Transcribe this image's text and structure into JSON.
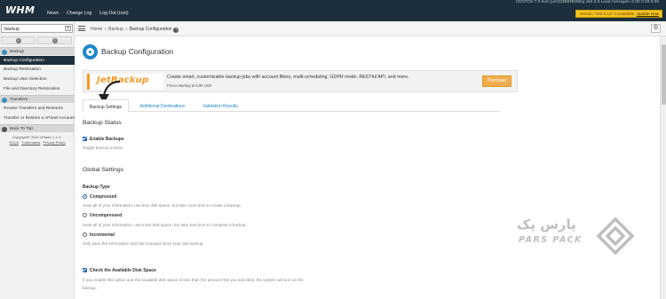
{
  "header": {
    "logo": "WHM",
    "nav": [
      "News",
      "Change Log",
      "Log Out (root)"
    ],
    "server_info": "CENTOS 7.9 kvm [vm2335935268u]   v94.0.8        Load Averages: 0.02 0.03 0.05",
    "update_notice": "Version \"102.0.12\" is available.",
    "update_link": "Update Now"
  },
  "sidebar": {
    "search_value": "backup",
    "clear_label": "×",
    "categories": [
      {
        "label": "Backup"
      },
      {
        "label": "Transfers"
      },
      {
        "label": "Back To Top"
      }
    ],
    "items": [
      {
        "label": "Backup Configuration",
        "active": true
      },
      {
        "label": "Backup Restoration",
        "active": false
      },
      {
        "label": "Backup User Selection",
        "active": false
      },
      {
        "label": "File and Directory Restoration",
        "active": false
      },
      {
        "label": "Review Transfers and Restores",
        "active": false
      },
      {
        "label": "Transfer or Restore a cPanel Account",
        "active": false
      }
    ],
    "footer_copyright": "Copyright© 2022 cPanel, L.L.C.",
    "footer_links": [
      "EULA",
      "Trademarks",
      "Privacy Policy"
    ]
  },
  "breadcrumb": {
    "items": [
      "Home",
      "Backup",
      "Backup Configuration"
    ],
    "separator": "»"
  },
  "page": {
    "title": "Backup Configuration",
    "icon": "backup-config-icon"
  },
  "promo": {
    "logo_text": "JetBackup",
    "text": "Create smart, customizable backup jobs with account filters, multi-scheduling, GDPR mode, RESTful API, and more.",
    "price": "Prices starting at 5.95 USD",
    "button": "Purchase"
  },
  "tabs": [
    {
      "label": "Backup Settings",
      "active": true
    },
    {
      "label": "Additional Destinations",
      "active": false
    },
    {
      "label": "Validation Results",
      "active": false
    }
  ],
  "backup_status": {
    "title": "Backup Status",
    "enable_label": "Enable Backups",
    "enable_checked": true,
    "enable_hint": "Toggle backup activity."
  },
  "global_settings": {
    "title": "Global Settings",
    "type_label": "Backup Type",
    "options": [
      {
        "label": "Compressed",
        "selected": true,
        "hint": "Save all of your information, use less disk space, but take more time to create a backup."
      },
      {
        "label": "Uncompressed",
        "selected": false,
        "hint": "Save all of your information, use more disk space, but take less time to complete a backup."
      },
      {
        "label": "Incremental",
        "selected": false,
        "hint": "Only save the information that has changed since your last backup."
      }
    ],
    "disk_check_label": "Check the Available Disk Space",
    "disk_check_checked": true,
    "disk_check_hint_1": "If you enable this option and the available disk space is less than the amount that you specified, the system will not run the",
    "disk_check_hint_2": "backup."
  },
  "watermark": {
    "fa_text": "پارس پک",
    "en_text": "PARS PACK"
  },
  "colors": {
    "topbar": "#1d2f3d",
    "accent_blue": "#1e88c9",
    "jetbackup_orange": "#f29a25",
    "purchase_button": "#f0ad4e",
    "update_badge": "#f5c525"
  }
}
